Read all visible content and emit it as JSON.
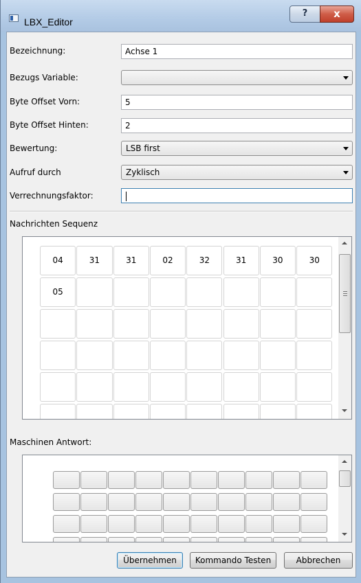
{
  "window": {
    "title": "LBX_Editor",
    "help_label": "?",
    "close_label": "x"
  },
  "form": {
    "bezeichnung": {
      "label": "Bezeichnung:",
      "value": "Achse 1"
    },
    "bezugs_variable": {
      "label": "Bezugs Variable:",
      "value": ""
    },
    "byte_offset_vorn": {
      "label": "Byte Offset Vorn:",
      "value": "5"
    },
    "byte_offset_hinten": {
      "label": "Byte Offset Hinten:",
      "value": "2"
    },
    "bewertung": {
      "label": "Bewertung:",
      "value": "LSB first"
    },
    "aufruf_durch": {
      "label": "Aufruf durch",
      "value": "Zyklisch"
    },
    "verrechnungsfaktor": {
      "label": "Verrechnungsfaktor:",
      "value": ""
    }
  },
  "sequence": {
    "label": "Nachrichten Sequenz",
    "rows": [
      [
        "04",
        "31",
        "31",
        "02",
        "32",
        "31",
        "30",
        "30"
      ],
      [
        "05",
        "",
        "",
        "",
        "",
        "",
        "",
        ""
      ],
      [
        "",
        "",
        "",
        "",
        "",
        "",
        "",
        ""
      ],
      [
        "",
        "",
        "",
        "",
        "",
        "",
        "",
        ""
      ],
      [
        "",
        "",
        "",
        "",
        "",
        "",
        "",
        ""
      ],
      [
        "",
        "",
        "",
        "",
        "",
        "",
        "",
        ""
      ]
    ]
  },
  "answer": {
    "label": "Maschinen Antwort:",
    "rows": 4,
    "cols": 10
  },
  "buttons": {
    "apply": "Übernehmen",
    "test": "Kommando Testen",
    "cancel": "Abbrechen"
  },
  "colors": {
    "frame": "#a7c3e0",
    "close_button": "#c0402b",
    "focus_border": "#3c7fb1"
  }
}
